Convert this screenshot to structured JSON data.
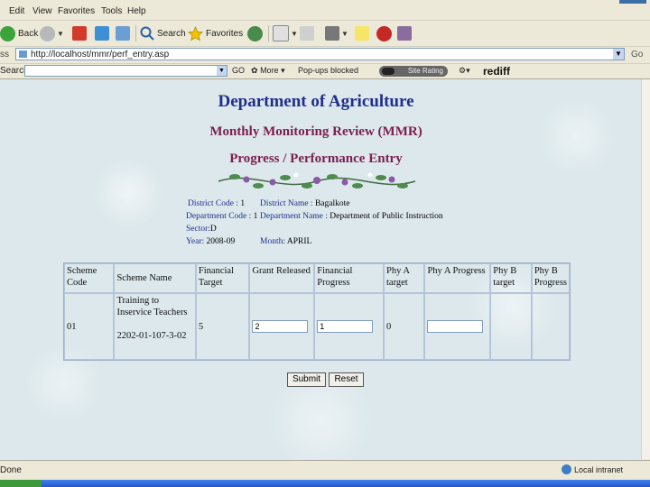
{
  "browser": {
    "menu": [
      "Edit",
      "View",
      "Favorites",
      "Tools",
      "Help"
    ],
    "toolbar": {
      "back_label": "Back",
      "search_label": "Search",
      "favorites_label": "Favorites"
    },
    "address": {
      "label": "ss",
      "url": "http://localhost/mmr/perf_entry.asp",
      "go": "Go"
    },
    "search_toolbar": {
      "label": "Search",
      "go": "GO",
      "more": "More",
      "popups": "Pop-ups blocked",
      "site_rating": "Site Rating",
      "brand": "rediff"
    },
    "status": {
      "left": "Done",
      "zone": "Local intranet"
    }
  },
  "page": {
    "dept_title": "Department of Agriculture",
    "mmr_title": "Monthly Monitoring Review (MMR)",
    "progress_title": "Progress / Performance Entry",
    "info": {
      "district_code_label": "District Code :",
      "district_code_value": "1",
      "district_name_label": "District Name :",
      "district_name_value": "Bagalkote",
      "department_code_label": "Department Code :",
      "department_code_value": "1",
      "department_name_label": "Department Name :",
      "department_name_value": "Department of Public Instruction",
      "sector_label": "Sector:",
      "sector_value": "D",
      "year_label": "Year:",
      "year_value": "2008-09",
      "month_label": "Month:",
      "month_value": "APRIL"
    },
    "table": {
      "headers": {
        "scheme_code": "Scheme Code",
        "scheme_name": "Scheme Name",
        "financial_target": "Financial Target",
        "grant_released": "Grant Released",
        "financial_progress": "Financial Progress",
        "phy_a_target": "Phy A target",
        "phy_a_progress": "Phy A Progress",
        "phy_b_target": "Phy B target",
        "phy_b_progress": "Phy B Progress"
      },
      "row": {
        "scheme_code": "01",
        "scheme_name": "Training to Inservice Teachers",
        "scheme_id": "2202-01-107-3-02",
        "financial_target": "5",
        "grant_released": "2",
        "financial_progress": "1",
        "phy_a_target": "0",
        "phy_a_progress": "",
        "phy_b_target": "",
        "phy_b_progress": ""
      }
    },
    "buttons": {
      "submit": "Submit",
      "reset": "Reset"
    }
  },
  "colors": {
    "dept_title": "#1f2f8a",
    "subtitle": "#7a1f4f",
    "label": "#1f2f8a",
    "page_bg": "#dce8ec"
  }
}
